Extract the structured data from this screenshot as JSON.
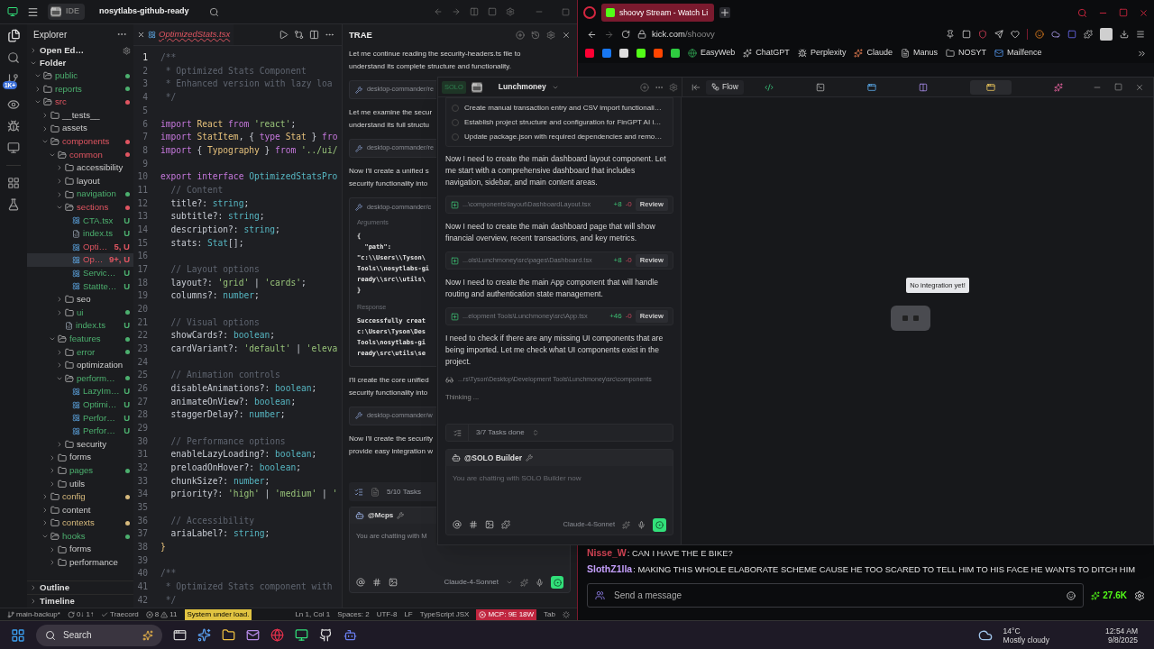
{
  "ide": {
    "tab_label": "IDE",
    "project": "nosytlabs-github-ready",
    "activity_badge": "1K+"
  },
  "explorer": {
    "title": "Explorer",
    "sections": [
      {
        "label": "Open Ed…",
        "expanded": false
      },
      {
        "label": "Folder",
        "expanded": true
      }
    ],
    "tree": [
      {
        "label": "public",
        "kind": "folder",
        "expanded": true,
        "color": "#4caf6e",
        "dot": true,
        "selected": false
      },
      {
        "label": "reports",
        "kind": "folder",
        "expanded": false,
        "color": "#4caf6e",
        "dot": true,
        "selected": false
      },
      {
        "label": "src",
        "kind": "folder",
        "expanded": true,
        "color": "#e05561",
        "dot": true,
        "selected": false,
        "children": [
          {
            "label": "__tests__",
            "kind": "folder",
            "expanded": false,
            "dot": false,
            "selected": false
          },
          {
            "label": "assets",
            "kind": "folder",
            "expanded": false,
            "dot": false,
            "selected": false
          },
          {
            "label": "components",
            "kind": "folder",
            "expanded": true,
            "color": "#e05561",
            "dot": true,
            "selected": false,
            "children": [
              {
                "label": "common",
                "kind": "folder",
                "expanded": true,
                "color": "#e05561",
                "dot": true,
                "selected": false,
                "children": [
                  {
                    "label": "accessibility",
                    "kind": "folder",
                    "expanded": false,
                    "dot": false,
                    "selected": false
                  },
                  {
                    "label": "layout",
                    "kind": "folder",
                    "expanded": false,
                    "dot": false,
                    "selected": false
                  },
                  {
                    "label": "navigation",
                    "kind": "folder",
                    "expanded": false,
                    "color": "#4caf6e",
                    "dot": true,
                    "selected": false
                  },
                  {
                    "label": "sections",
                    "kind": "folder",
                    "expanded": true,
                    "color": "#e05561",
                    "dot": true,
                    "selected": false,
                    "children": [
                      {
                        "label": "CTA.tsx",
                        "kind": "react",
                        "color": "#4caf6e",
                        "status": "U",
                        "selected": false
                      },
                      {
                        "label": "index.ts",
                        "kind": "ts",
                        "color": "#4caf6e",
                        "status": "U",
                        "selected": false
                      },
                      {
                        "label": "Opti…",
                        "kind": "react",
                        "color": "#e05561",
                        "status": "5, U",
                        "selected": false
                      },
                      {
                        "label": "Op…",
                        "kind": "react",
                        "color": "#e05561",
                        "status": "9+, U",
                        "selected": true
                      },
                      {
                        "label": "Servic…",
                        "kind": "react",
                        "color": "#4caf6e",
                        "status": "U",
                        "selected": false
                      },
                      {
                        "label": "StatIte…",
                        "kind": "react",
                        "color": "#4caf6e",
                        "status": "U",
                        "selected": false
                      }
                    ]
                  },
                  {
                    "label": "seo",
                    "kind": "folder",
                    "expanded": false,
                    "dot": false,
                    "selected": false
                  },
                  {
                    "label": "ui",
                    "kind": "folder",
                    "expanded": false,
                    "color": "#4caf6e",
                    "dot": true,
                    "selected": false
                  },
                  {
                    "label": "index.ts",
                    "kind": "ts",
                    "color": "#4caf6e",
                    "status": "U",
                    "selected": false
                  }
                ]
              },
              {
                "label": "features",
                "kind": "folder",
                "expanded": true,
                "color": "#4caf6e",
                "dot": true,
                "selected": false,
                "children": [
                  {
                    "label": "error",
                    "kind": "folder",
                    "expanded": false,
                    "color": "#4caf6e",
                    "dot": true,
                    "selected": false
                  },
                  {
                    "label": "optimization",
                    "kind": "folder",
                    "expanded": false,
                    "dot": false,
                    "selected": false
                  },
                  {
                    "label": "perform…",
                    "kind": "folder",
                    "expanded": true,
                    "color": "#4caf6e",
                    "dot": true,
                    "selected": false,
                    "children": [
                      {
                        "label": "LazyIm…",
                        "kind": "react",
                        "color": "#4caf6e",
                        "status": "U",
                        "selected": false
                      },
                      {
                        "label": "Optimi…",
                        "kind": "react",
                        "color": "#4caf6e",
                        "status": "U",
                        "selected": false
                      },
                      {
                        "label": "Perfor…",
                        "kind": "react",
                        "color": "#4caf6e",
                        "status": "U",
                        "selected": false
                      },
                      {
                        "label": "Perfor…",
                        "kind": "react",
                        "color": "#4caf6e",
                        "status": "U",
                        "selected": false
                      }
                    ]
                  },
                  {
                    "label": "security",
                    "kind": "folder",
                    "expanded": false,
                    "dot": false,
                    "selected": false
                  }
                ]
              },
              {
                "label": "forms",
                "kind": "folder",
                "expanded": false,
                "dot": false,
                "selected": false
              },
              {
                "label": "pages",
                "kind": "folder",
                "expanded": false,
                "color": "#4caf6e",
                "dot": true,
                "selected": false
              },
              {
                "label": "utils",
                "kind": "folder",
                "expanded": false,
                "dot": false,
                "selected": false
              }
            ]
          },
          {
            "label": "config",
            "kind": "folder",
            "expanded": false,
            "color": "#d7ba7d",
            "dot": true,
            "selected": false
          },
          {
            "label": "content",
            "kind": "folder",
            "expanded": false,
            "dot": false,
            "selected": false
          },
          {
            "label": "contexts",
            "kind": "folder",
            "expanded": false,
            "color": "#d7ba7d",
            "dot": true,
            "selected": false
          },
          {
            "label": "hooks",
            "kind": "folder",
            "expanded": true,
            "color": "#4caf6e",
            "dot": true,
            "selected": false,
            "children": [
              {
                "label": "forms",
                "kind": "folder",
                "expanded": false,
                "dot": false,
                "selected": false
              },
              {
                "label": "performance",
                "kind": "folder",
                "expanded": false,
                "dot": false,
                "selected": false
              }
            ]
          }
        ]
      }
    ],
    "footer": [
      {
        "label": "Outline",
        "expanded": false
      },
      {
        "label": "Timeline",
        "expanded": false
      }
    ]
  },
  "editor": {
    "tab": "OptimizedStats.tsx",
    "lines": [
      {
        "no": "1",
        "tokens": [
          {
            "kind": "c",
            "text": "/**"
          }
        ]
      },
      {
        "no": "2",
        "tokens": [
          {
            "kind": "c",
            "text": " * Optimized Stats Component"
          }
        ]
      },
      {
        "no": "3",
        "tokens": [
          {
            "kind": "c",
            "text": " * Enhanced version with lazy loa"
          }
        ]
      },
      {
        "no": "4",
        "tokens": [
          {
            "kind": "c",
            "text": " */"
          }
        ]
      },
      {
        "no": "5"
      },
      {
        "no": "6",
        "tokens": [
          {
            "kind": "k",
            "text": "import "
          },
          {
            "kind": "t",
            "text": "React "
          },
          {
            "kind": "k",
            "text": "from "
          },
          {
            "kind": "s",
            "text": "'react'"
          },
          {
            "kind": "p",
            "text": ";"
          }
        ]
      },
      {
        "no": "7",
        "tokens": [
          {
            "kind": "k",
            "text": "import "
          },
          {
            "kind": "t",
            "text": "StatItem"
          },
          {
            "kind": "p",
            "text": ", { "
          },
          {
            "kind": "k",
            "text": "type "
          },
          {
            "kind": "t",
            "text": "Stat "
          },
          {
            "kind": "p",
            "text": "} "
          },
          {
            "kind": "k",
            "text": "fro"
          }
        ]
      },
      {
        "no": "8",
        "tokens": [
          {
            "kind": "k",
            "text": "import "
          },
          {
            "kind": "p",
            "text": "{ "
          },
          {
            "kind": "t",
            "text": "Typography "
          },
          {
            "kind": "p",
            "text": "} "
          },
          {
            "kind": "k",
            "text": "from "
          },
          {
            "kind": "s",
            "text": "'../ui/"
          }
        ]
      },
      {
        "no": "9"
      },
      {
        "no": "10",
        "tokens": [
          {
            "kind": "k",
            "text": "export interface "
          },
          {
            "kind": "b",
            "text": "OptimizedStatsPro"
          }
        ]
      },
      {
        "no": "11",
        "tokens": [
          {
            "kind": "c",
            "text": "  // Content"
          }
        ]
      },
      {
        "no": "12",
        "tokens": [
          {
            "kind": "p",
            "text": "  title?: "
          },
          {
            "kind": "b",
            "text": "string"
          },
          {
            "kind": "p",
            "text": ";"
          }
        ]
      },
      {
        "no": "13",
        "tokens": [
          {
            "kind": "p",
            "text": "  subtitle?: "
          },
          {
            "kind": "b",
            "text": "string"
          },
          {
            "kind": "p",
            "text": ";"
          }
        ]
      },
      {
        "no": "14",
        "tokens": [
          {
            "kind": "p",
            "text": "  description?: "
          },
          {
            "kind": "b",
            "text": "string"
          },
          {
            "kind": "p",
            "text": ";"
          }
        ]
      },
      {
        "no": "15",
        "tokens": [
          {
            "kind": "p",
            "text": "  stats: "
          },
          {
            "kind": "b",
            "text": "Stat"
          },
          {
            "kind": "p",
            "text": "[];"
          }
        ]
      },
      {
        "no": "16"
      },
      {
        "no": "17",
        "tokens": [
          {
            "kind": "c",
            "text": "  // Layout options"
          }
        ]
      },
      {
        "no": "18",
        "tokens": [
          {
            "kind": "p",
            "text": "  layout?: "
          },
          {
            "kind": "s",
            "text": "'grid'"
          },
          {
            "kind": "p",
            "text": " | "
          },
          {
            "kind": "s",
            "text": "'cards'"
          },
          {
            "kind": "p",
            "text": ";"
          }
        ]
      },
      {
        "no": "19",
        "tokens": [
          {
            "kind": "p",
            "text": "  columns?: "
          },
          {
            "kind": "b",
            "text": "number"
          },
          {
            "kind": "p",
            "text": ";"
          }
        ]
      },
      {
        "no": "20"
      },
      {
        "no": "21",
        "tokens": [
          {
            "kind": "c",
            "text": "  // Visual options"
          }
        ]
      },
      {
        "no": "22",
        "tokens": [
          {
            "kind": "p",
            "text": "  showCards?: "
          },
          {
            "kind": "b",
            "text": "boolean"
          },
          {
            "kind": "p",
            "text": ";"
          }
        ]
      },
      {
        "no": "23",
        "tokens": [
          {
            "kind": "p",
            "text": "  cardVariant?: "
          },
          {
            "kind": "s",
            "text": "'default'"
          },
          {
            "kind": "p",
            "text": " | "
          },
          {
            "kind": "s",
            "text": "'eleva"
          }
        ]
      },
      {
        "no": "24"
      },
      {
        "no": "25",
        "tokens": [
          {
            "kind": "c",
            "text": "  // Animation controls"
          }
        ]
      },
      {
        "no": "26",
        "tokens": [
          {
            "kind": "p",
            "text": "  disableAnimations?: "
          },
          {
            "kind": "b",
            "text": "boolean"
          },
          {
            "kind": "p",
            "text": ";"
          }
        ]
      },
      {
        "no": "27",
        "tokens": [
          {
            "kind": "p",
            "text": "  animateOnView?: "
          },
          {
            "kind": "b",
            "text": "boolean"
          },
          {
            "kind": "p",
            "text": ";"
          }
        ]
      },
      {
        "no": "28",
        "tokens": [
          {
            "kind": "p",
            "text": "  staggerDelay?: "
          },
          {
            "kind": "b",
            "text": "number"
          },
          {
            "kind": "p",
            "text": ";"
          }
        ]
      },
      {
        "no": "29"
      },
      {
        "no": "30",
        "tokens": [
          {
            "kind": "c",
            "text": "  // Performance options"
          }
        ]
      },
      {
        "no": "31",
        "tokens": [
          {
            "kind": "p",
            "text": "  enableLazyLoading?: "
          },
          {
            "kind": "b",
            "text": "boolean"
          },
          {
            "kind": "p",
            "text": ";"
          }
        ]
      },
      {
        "no": "32",
        "tokens": [
          {
            "kind": "p",
            "text": "  preloadOnHover?: "
          },
          {
            "kind": "b",
            "text": "boolean"
          },
          {
            "kind": "p",
            "text": ";"
          }
        ]
      },
      {
        "no": "33",
        "tokens": [
          {
            "kind": "p",
            "text": "  chunkSize?: "
          },
          {
            "kind": "b",
            "text": "number"
          },
          {
            "kind": "p",
            "text": ";"
          }
        ]
      },
      {
        "no": "34",
        "tokens": [
          {
            "kind": "p",
            "text": "  priority?: "
          },
          {
            "kind": "s",
            "text": "'high'"
          },
          {
            "kind": "p",
            "text": " | "
          },
          {
            "kind": "s",
            "text": "'medium'"
          },
          {
            "kind": "p",
            "text": " | "
          },
          {
            "kind": "s",
            "text": "'"
          }
        ]
      },
      {
        "no": "35"
      },
      {
        "no": "36",
        "tokens": [
          {
            "kind": "c",
            "text": "  // Accessibility"
          }
        ]
      },
      {
        "no": "37",
        "tokens": [
          {
            "kind": "p",
            "text": "  ariaLabel?: "
          },
          {
            "kind": "b",
            "text": "string"
          },
          {
            "kind": "p",
            "text": ";"
          }
        ]
      },
      {
        "no": "38",
        "tokens": [
          {
            "kind": "t",
            "text": "}"
          }
        ]
      },
      {
        "no": "39"
      },
      {
        "no": "40",
        "tokens": [
          {
            "kind": "c",
            "text": "/**"
          }
        ]
      },
      {
        "no": "41",
        "tokens": [
          {
            "kind": "c",
            "text": " * Optimized Stats component with"
          }
        ]
      },
      {
        "no": "42",
        "tokens": [
          {
            "kind": "c",
            "text": " */"
          }
        ]
      }
    ]
  },
  "trae": {
    "title": "TRAE",
    "items": [
      {
        "kind": "message",
        "lines": [
          "Let me continue reading the security-headers.ts file to",
          "understand its complete structure and functionality."
        ]
      },
      {
        "kind": "tool",
        "label": "desktop-commander/re"
      },
      {
        "kind": "message",
        "lines": [
          "Let me examine the secur",
          "understand its full structu"
        ]
      },
      {
        "kind": "tool",
        "label": "desktop-commander/re"
      },
      {
        "kind": "message",
        "lines": [
          "Now I'll create a unified s",
          "security functionality into"
        ]
      },
      {
        "kind": "tool_detail",
        "label": "desktop-commander/c",
        "args_title": "Arguments",
        "args": [
          "{",
          "  \"path\":",
          "\"c:\\\\Users\\\\Tyson\\",
          "Tools\\\\nosytlabs-gi",
          "ready\\\\src\\\\utils\\",
          "}"
        ],
        "response_title": "Response",
        "response": [
          "Successfully creat",
          "c:\\Users\\Tyson\\Des",
          "Tools\\nosytlabs-gi",
          "ready\\src\\utils\\se"
        ]
      },
      {
        "kind": "message",
        "lines": [
          "I'll create the core unified",
          "security functionality into"
        ]
      },
      {
        "kind": "tool",
        "label": "desktop-commander/w"
      },
      {
        "kind": "message",
        "lines": [
          "Now I'll create the security",
          "provide easy integration w"
        ]
      }
    ],
    "tasks": "5/10 Tasks",
    "agent": "@Mcps",
    "placeholder": "You are chatting with M",
    "model": "Claude-4-Sonnet"
  },
  "solo": {
    "badge": "SOLO",
    "project": "Lunchmoney",
    "tasks": [
      {
        "label": "Create manual transaction entry and CSV import functionali…",
        "checked": false
      },
      {
        "label": "Establish project structure and configuration for FinGPT AI i…",
        "checked": false
      },
      {
        "label": "Update package.json with required dependencies and remo…",
        "checked": false
      }
    ],
    "items": [
      {
        "kind": "message",
        "text": "Now I need to create the main dashboard layout component. Let me start with a comprehensive dashboard that includes navigation, sidebar, and main content areas."
      },
      {
        "kind": "file",
        "path": "...\\components\\layout\\DashboardLayout.tsx",
        "added": "+8",
        "removed": "-0",
        "action": "Review"
      },
      {
        "kind": "message",
        "text": "Now I need to create the main dashboard page that will show financial overview, recent transactions, and key metrics."
      },
      {
        "kind": "file",
        "path": "...ols\\Lunchmoney\\src\\pages\\Dashboard.tsx",
        "added": "+8",
        "removed": "-0",
        "action": "Review"
      },
      {
        "kind": "message",
        "text": "Now I need to create the main App component that will handle routing and authentication state management."
      },
      {
        "kind": "file",
        "path": "...elopment Tools\\Lunchmoney\\src\\App.tsx",
        "added": "+46",
        "removed": "-0",
        "action": "Review"
      },
      {
        "kind": "message",
        "text": "I need to check if there are any missing UI components that are being imported. Let me check what UI components exist in the project."
      },
      {
        "kind": "reading",
        "path": "...rs\\Tyson\\Desktop\\Development Tools\\Lunchmoney\\src\\components"
      },
      {
        "kind": "status",
        "text": "Thinking ..."
      }
    ],
    "tasks_done": "3/7 Tasks done",
    "agent": "@SOLO Builder",
    "placeholder": "You are chatting with SOLO Builder now",
    "model": "Claude-4-Sonnet",
    "flow_tab": "Flow",
    "tooltip": "No integration yet!"
  },
  "browser": {
    "tab": "shoovy Stream - Watch Li",
    "url_host": "kick.com",
    "url_path": "/shoovy",
    "bookmarks": [
      "EasyWeb",
      "ChatGPT",
      "Perplexity",
      "Claude",
      "Manus",
      "NOSYT",
      "Mailfence"
    ]
  },
  "chat": {
    "messages": [
      {
        "user": "Nisse_W",
        "color": "#e0485a",
        "text": ": CAN I HAVE THE E BIKE?"
      },
      {
        "user": "SlothZ1lla",
        "color": "#c8a2ff",
        "text": ": MAKING THIS WHOLE ELABORATE SCHEME CAUSE HE TOO SCARED TO TELL HIM TO HIS FACE HE WANTS TO DITCH HIM"
      }
    ],
    "placeholder": "Send a message",
    "viewers": "27.6K"
  },
  "status_bar": {
    "branch": "main-backup*",
    "sync": "0↓ 1↑",
    "extension": "Traecord",
    "errors": "8",
    "warnings": "11",
    "notice": "System under load.",
    "position": "Ln 1, Col 1",
    "indent": "Spaces: 2",
    "encoding": "UTF-8",
    "eol": "LF",
    "language": "TypeScript JSX",
    "mcp": "MCP: 9E 18W",
    "tab": "Tab"
  },
  "taskbar": {
    "search": "Search",
    "temperature": "14°C",
    "weather": "Mostly cloudy",
    "time": "12:54 AM",
    "date": "9/8/2025"
  }
}
